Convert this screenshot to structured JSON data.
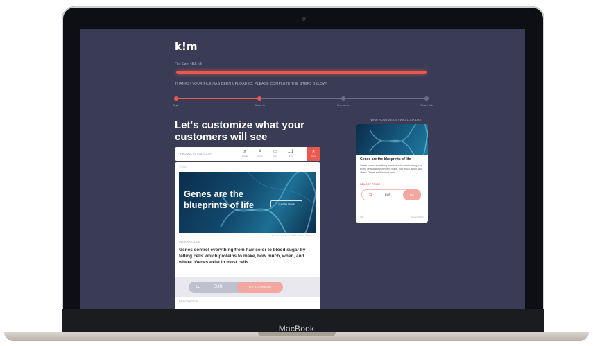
{
  "device": {
    "brand": "MacBook"
  },
  "app": {
    "logo": "k!m",
    "file_size": "File Size: 48.5 kB",
    "upload_progress": 1.0,
    "upload_message": "THANKS! YOUR FILE HAS BEEN UPLOADED. PLEASE COMPLETE THE STEPS BELOW!",
    "steps": [
      {
        "label": "Style",
        "state": "done"
      },
      {
        "label": "Check in",
        "state": "current"
      },
      {
        "label": "Payments",
        "state": "todo"
      },
      {
        "label": "Share link",
        "state": "todo"
      }
    ],
    "step_progress": 0.33,
    "heading": "Let's customize what your customers will see"
  },
  "toolbar": {
    "label": "PRODUCT'S CATEGORY",
    "tools": [
      {
        "icon": "search-icon",
        "glyph": "⌕",
        "label": "Image"
      },
      {
        "icon": "text-icon",
        "glyph": "A",
        "label": "Fonts"
      },
      {
        "icon": "file-icon",
        "glyph": "▭",
        "label": "Icon"
      },
      {
        "icon": "ratio-icon",
        "glyph": "1:1",
        "label": "Size"
      }
    ],
    "close": {
      "glyph": "✕",
      "label": "Done"
    }
  },
  "editor": {
    "style_label": "TITLE",
    "hero_title": "Genes are the blueprints of life",
    "hero_button": "CHANGE IMAGE",
    "image_caption": "Recommended size: 1280 x 720 px, 5MB max",
    "intro_label": "INTRODUCTION",
    "intro_text": "Genes control everything from hair color to blood sugar by telling cells which proteins to make, how much, when, and where. Genes exist in most cells.",
    "pill": {
      "icon_glyph": "⇆",
      "currency": "EUR",
      "button": "BUY & DOWNLOAD"
    },
    "description_label": "DESCRIPTION"
  },
  "preview": {
    "label": "WHAT YOUR WIDGET WILL LOOK LIKE",
    "title": "Genes are the blueprints of life",
    "text": "Genes control everything from hair color to blood sugar by telling cells which proteins to make, how much, when, and where. Genes exist in most cells.",
    "price_label": "SELECT PRICE",
    "pill": {
      "icon_glyph": "⇆",
      "currency": "EUR",
      "button": "BUY"
    },
    "footer_left": "KIM",
    "footer_right": "Privacy Policy"
  },
  "colors": {
    "accent": "#e8594f",
    "screen_bg": "#3a3c55",
    "track": "#6b6d85"
  }
}
